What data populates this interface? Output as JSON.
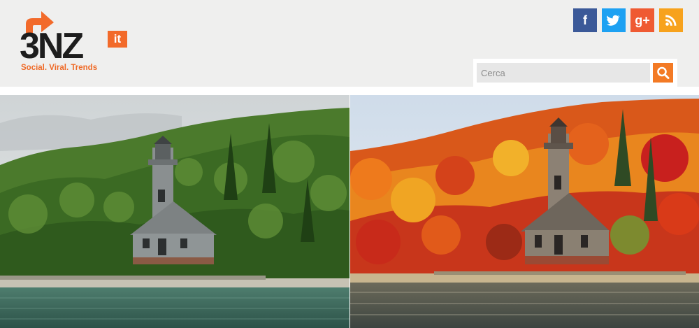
{
  "logo": {
    "text": "3NZ",
    "suffix": "it",
    "tagline": "Social. Viral. Trends",
    "accent_color": "#f26a2a"
  },
  "social": {
    "facebook": {
      "icon": "facebook-icon",
      "glyph": "f",
      "color": "#3b5998"
    },
    "twitter": {
      "icon": "twitter-icon",
      "glyph": "",
      "color": "#1da1f2"
    },
    "google_plus": {
      "icon": "google-plus-icon",
      "glyph": "g+",
      "color": "#ef5a32"
    },
    "rss": {
      "icon": "rss-icon",
      "glyph": "",
      "color": "#f7a21c"
    }
  },
  "search": {
    "placeholder": "Cerca",
    "button_icon": "search-icon",
    "button_color": "#f37a25"
  },
  "images": [
    {
      "name": "lighthouse-summer",
      "season": "summer",
      "dominant_color": "#3f6b2c"
    },
    {
      "name": "lighthouse-autumn",
      "season": "autumn",
      "dominant_color": "#e0611e"
    }
  ]
}
